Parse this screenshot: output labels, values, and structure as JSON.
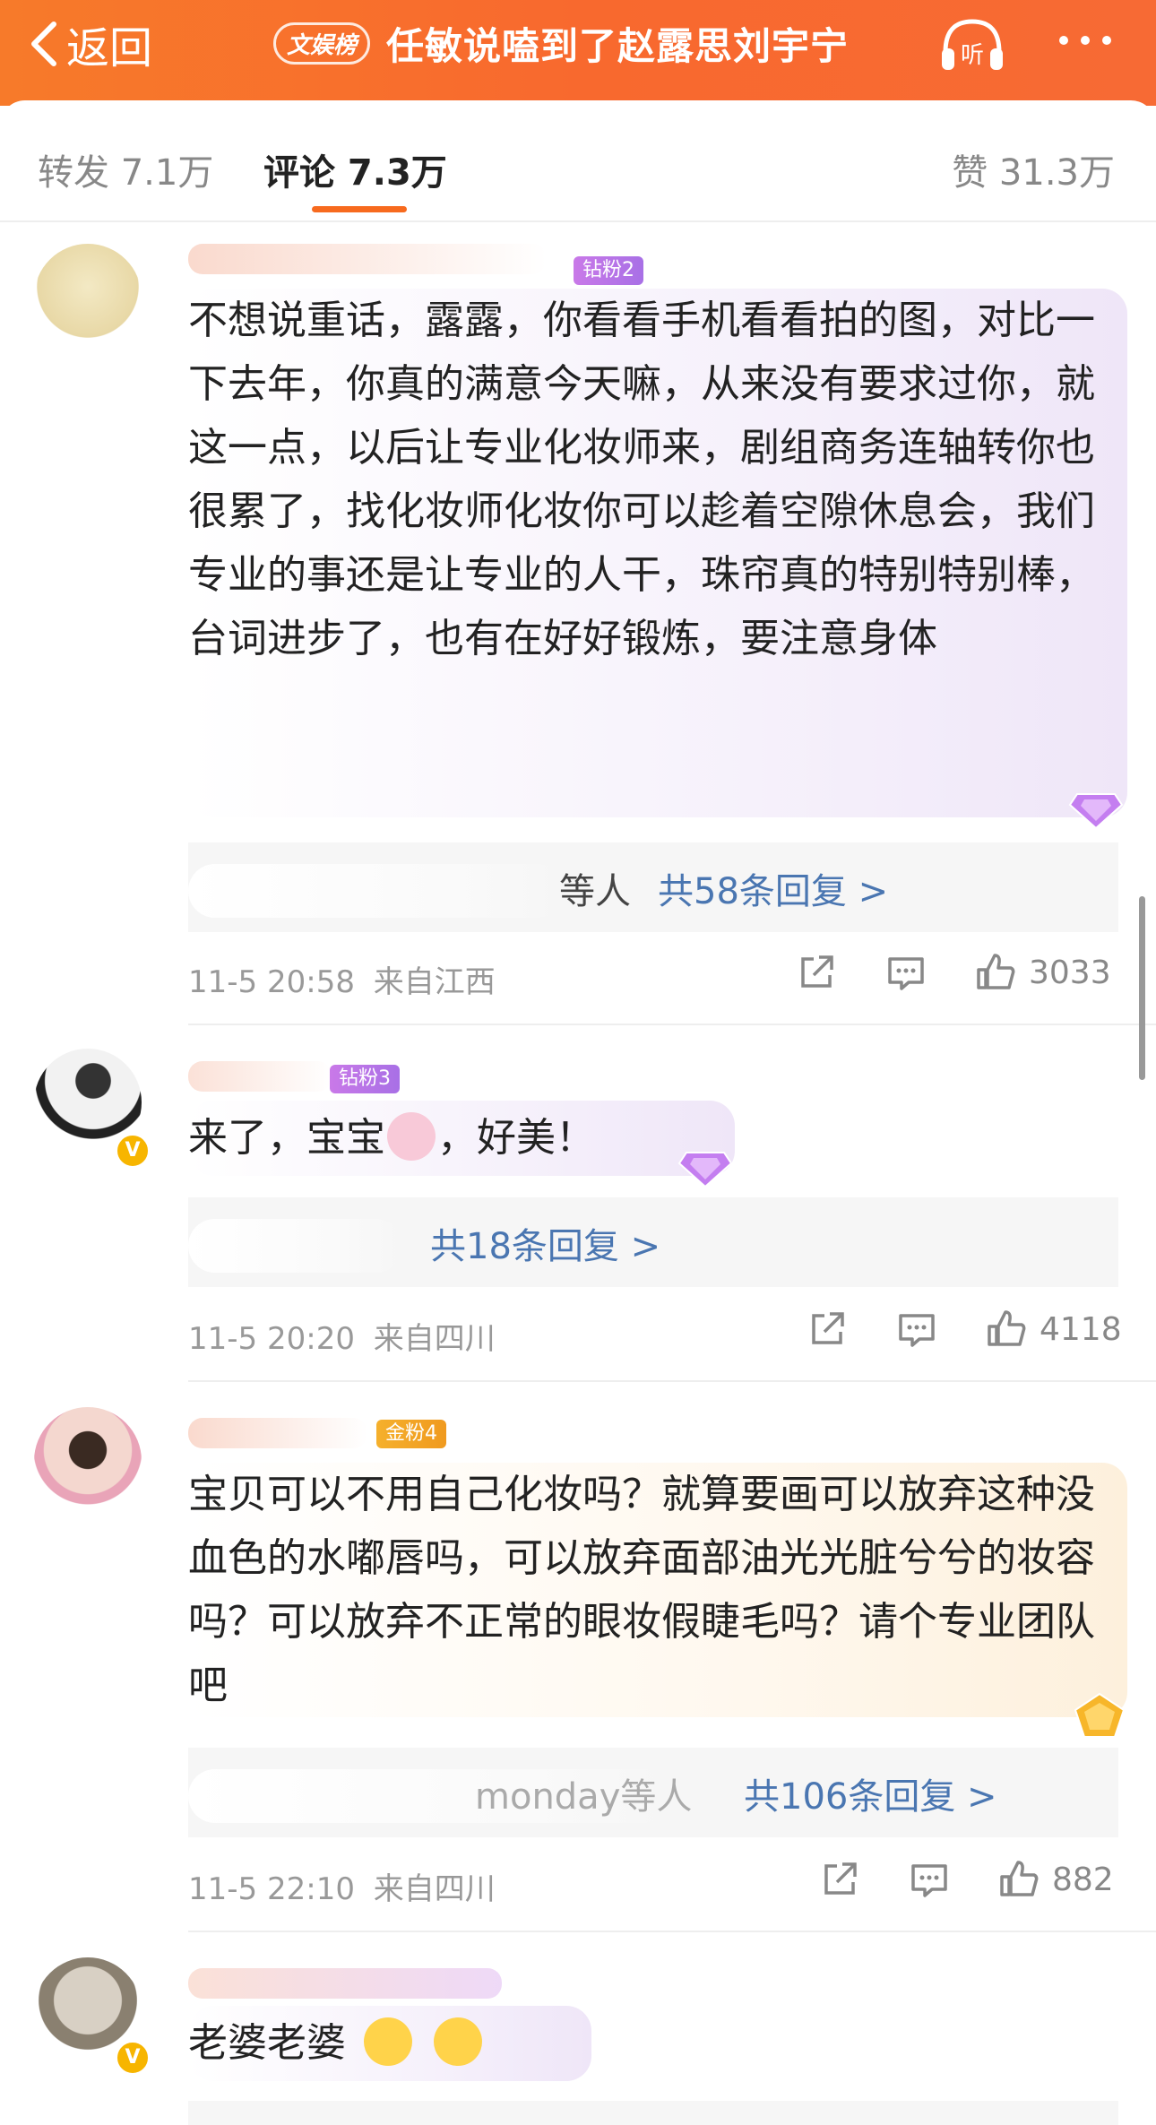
{
  "header": {
    "back_label": "返回",
    "tag": "文娱榜",
    "title": "任敏说嗑到了赵露思刘宇宁",
    "listen_label": "听"
  },
  "tabs": {
    "repost": "转发 7.1万",
    "comments": "评论 7.3万",
    "likes": "赞 31.3万"
  },
  "comments": [
    {
      "badge": "钻粉2",
      "text": "不想说重话，露露，你看看手机看看拍的图，对比一下去年，你真的满意今天嘛，从来没有要求过你，就这一点，以后让专业化妆师来，剧组商务连轴转你也很累了，找化妆师化妆你可以趁着空隙休息会，我们专业的事还是让专业的人干，珠帘真的特别特别棒，台词进步了，也有在好好锻炼，要注意身体",
      "reply_who": "等人",
      "reply_count": "共58条回复 >",
      "time": "11-5 20:58",
      "location": "来自江西",
      "likes": "3033"
    },
    {
      "badge": "钻粉3",
      "text_a": "来了，宝宝",
      "text_b": "，好美！",
      "reply_who": "",
      "reply_count": "共18条回复 >",
      "time": "11-5 20:20",
      "location": "来自四川",
      "likes": "4118"
    },
    {
      "badge": "金粉4",
      "text": "宝贝可以不用自己化妆吗？就算要画可以放弃这种没血色的水嘟唇吗，可以放弃面部油光光脏兮兮的妆容吗？可以放弃不正常的眼妆假睫毛吗？请个专业团队吧",
      "reply_who": "monday等人",
      "reply_count": "共106条回复 >",
      "time": "11-5 22:10",
      "location": "来自四川",
      "likes": "882"
    },
    {
      "text": "老婆老婆"
    }
  ],
  "colors": {
    "header_orange": "#f8692e",
    "link_blue": "#4a76b1",
    "tab_underline": "#f76a1e"
  },
  "icons": [
    "chevron-left-icon",
    "headphones-icon",
    "more-dots-icon",
    "share-icon",
    "comment-icon",
    "thumbs-up-icon",
    "diamond-gem-icon",
    "gold-gem-icon",
    "bunny-emoji",
    "smile-emoji"
  ]
}
